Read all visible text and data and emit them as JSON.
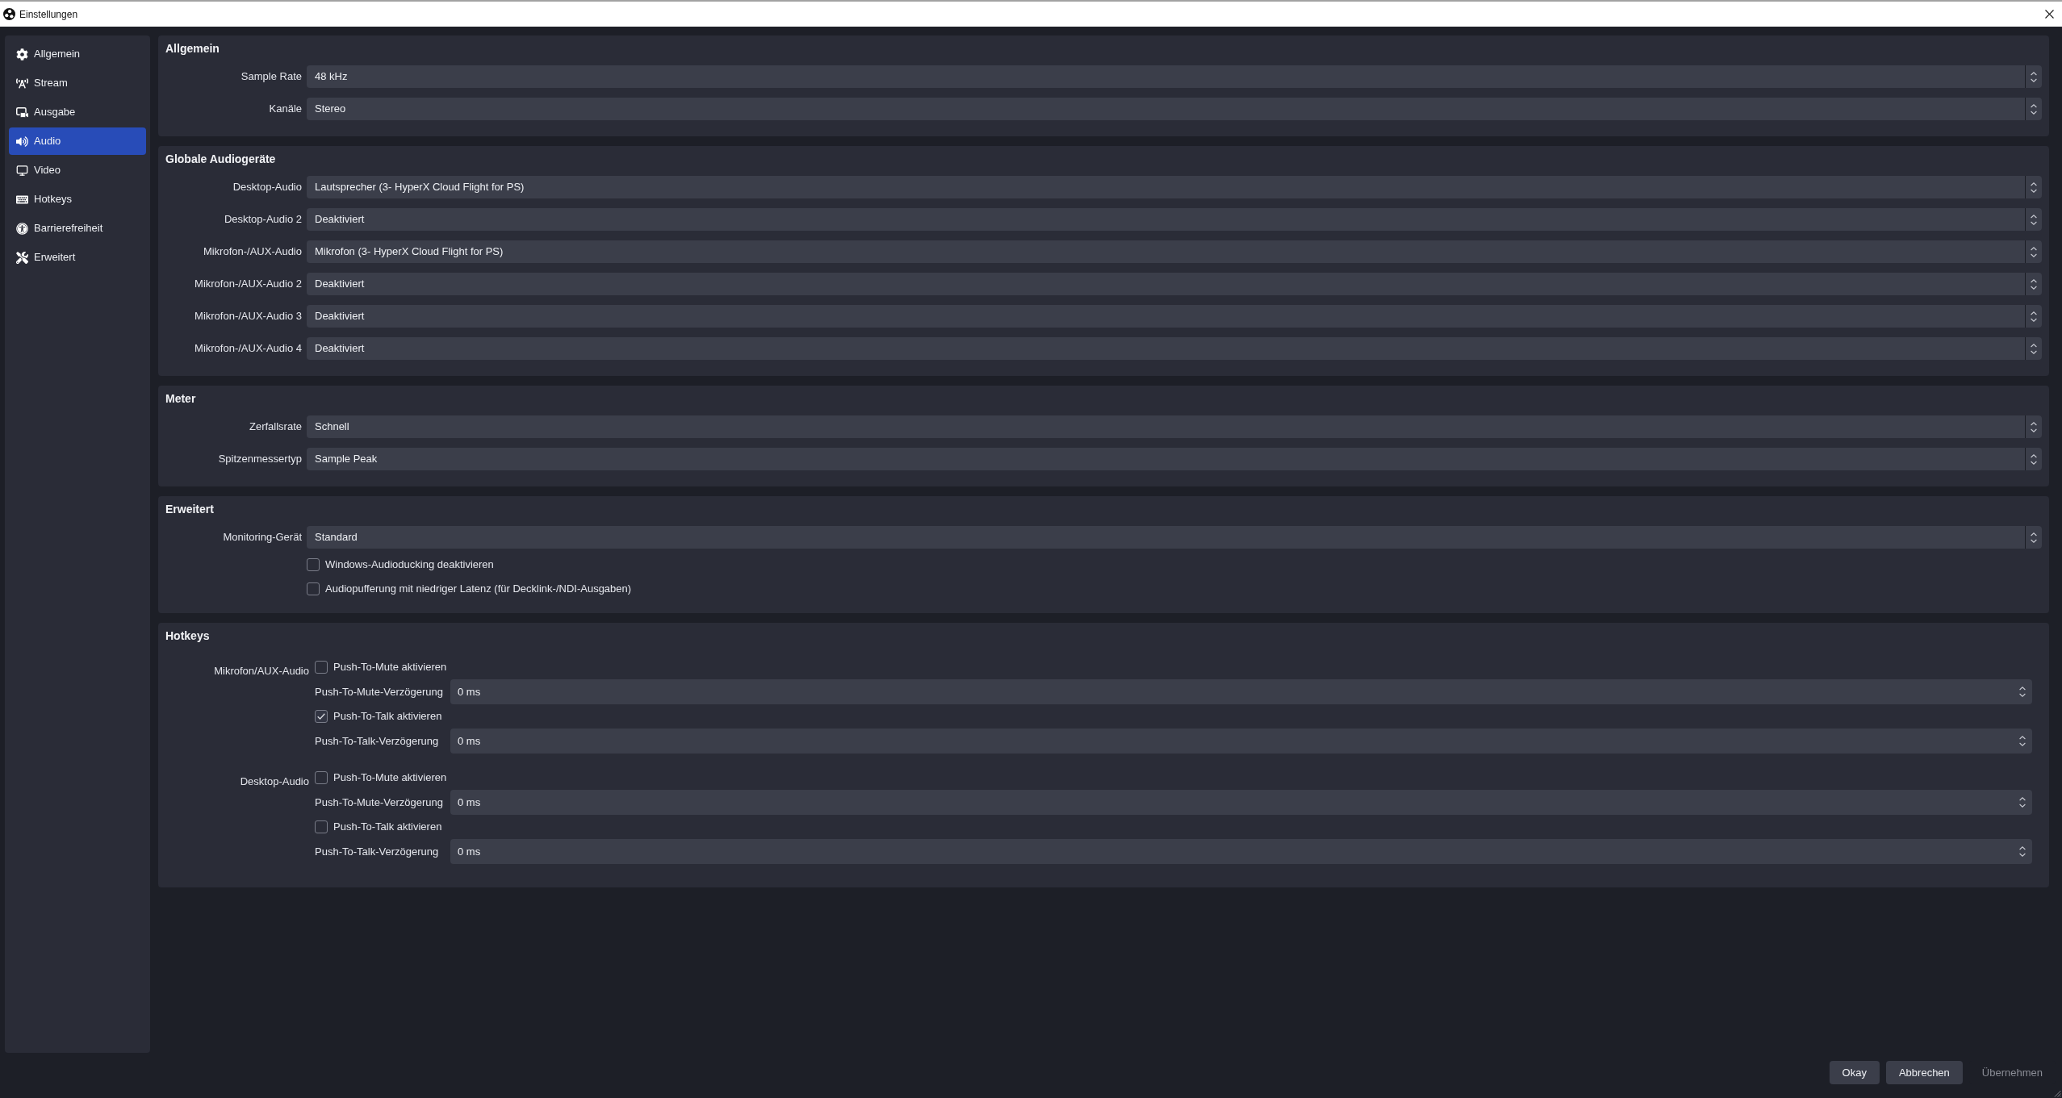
{
  "window": {
    "title": "Einstellungen"
  },
  "sidebar": {
    "items": [
      {
        "label": "Allgemein",
        "selected": false
      },
      {
        "label": "Stream",
        "selected": false
      },
      {
        "label": "Ausgabe",
        "selected": false
      },
      {
        "label": "Audio",
        "selected": true
      },
      {
        "label": "Video",
        "selected": false
      },
      {
        "label": "Hotkeys",
        "selected": false
      },
      {
        "label": "Barrierefreiheit",
        "selected": false
      },
      {
        "label": "Erweitert",
        "selected": false
      }
    ]
  },
  "sections": [
    {
      "kind": "form",
      "title": "Allgemein",
      "rows": [
        {
          "kind": "dropdown",
          "label": "Sample Rate",
          "value": "48 kHz"
        },
        {
          "kind": "dropdown",
          "label": "Kanäle",
          "value": "Stereo"
        }
      ]
    },
    {
      "kind": "form",
      "title": "Globale Audiogeräte",
      "rows": [
        {
          "kind": "dropdown",
          "label": "Desktop-Audio",
          "value": "Lautsprecher (3- HyperX Cloud Flight for PS)"
        },
        {
          "kind": "dropdown",
          "label": "Desktop-Audio 2",
          "value": "Deaktiviert"
        },
        {
          "kind": "dropdown",
          "label": "Mikrofon-/AUX-Audio",
          "value": "Mikrofon (3- HyperX Cloud Flight for PS)"
        },
        {
          "kind": "dropdown",
          "label": "Mikrofon-/AUX-Audio 2",
          "value": "Deaktiviert"
        },
        {
          "kind": "dropdown",
          "label": "Mikrofon-/AUX-Audio 3",
          "value": "Deaktiviert"
        },
        {
          "kind": "dropdown",
          "label": "Mikrofon-/AUX-Audio 4",
          "value": "Deaktiviert"
        }
      ]
    },
    {
      "kind": "form",
      "title": "Meter",
      "rows": [
        {
          "kind": "dropdown",
          "label": "Zerfallsrate",
          "value": "Schnell"
        },
        {
          "kind": "dropdown",
          "label": "Spitzenmessertyp",
          "value": "Sample Peak"
        }
      ]
    },
    {
      "kind": "form",
      "title": "Erweitert",
      "rows": [
        {
          "kind": "dropdown",
          "label": "Monitoring-Gerät",
          "value": "Standard"
        },
        {
          "kind": "checkbox",
          "label": "Windows-Audioducking deaktivieren",
          "checked": false
        },
        {
          "kind": "checkbox",
          "label": "Audiopufferung mit niedriger Latenz (für Decklink-/NDI-Ausgaben)",
          "checked": false
        }
      ]
    },
    {
      "kind": "hotkeys",
      "title": "Hotkeys",
      "groups": [
        {
          "label": "Mikrofon/AUX-Audio",
          "items": [
            {
              "kind": "checkbox",
              "label": "Push-To-Mute aktivieren",
              "checked": false
            },
            {
              "kind": "spinbox",
              "label": "Push-To-Mute-Verzögerung",
              "value": "0 ms"
            },
            {
              "kind": "checkbox",
              "label": "Push-To-Talk aktivieren",
              "checked": true
            },
            {
              "kind": "spinbox",
              "label": "Push-To-Talk-Verzögerung",
              "value": "0 ms"
            }
          ]
        },
        {
          "label": "Desktop-Audio",
          "items": [
            {
              "kind": "checkbox",
              "label": "Push-To-Mute aktivieren",
              "checked": false
            },
            {
              "kind": "spinbox",
              "label": "Push-To-Mute-Verzögerung",
              "value": "0 ms"
            },
            {
              "kind": "checkbox",
              "label": "Push-To-Talk aktivieren",
              "checked": false
            },
            {
              "kind": "spinbox",
              "label": "Push-To-Talk-Verzögerung",
              "value": "0 ms"
            }
          ]
        }
      ]
    }
  ],
  "buttons": [
    {
      "label": "Okay",
      "disabled": false
    },
    {
      "label": "Abbrechen",
      "disabled": false
    },
    {
      "label": "Übernehmen",
      "disabled": true
    }
  ]
}
